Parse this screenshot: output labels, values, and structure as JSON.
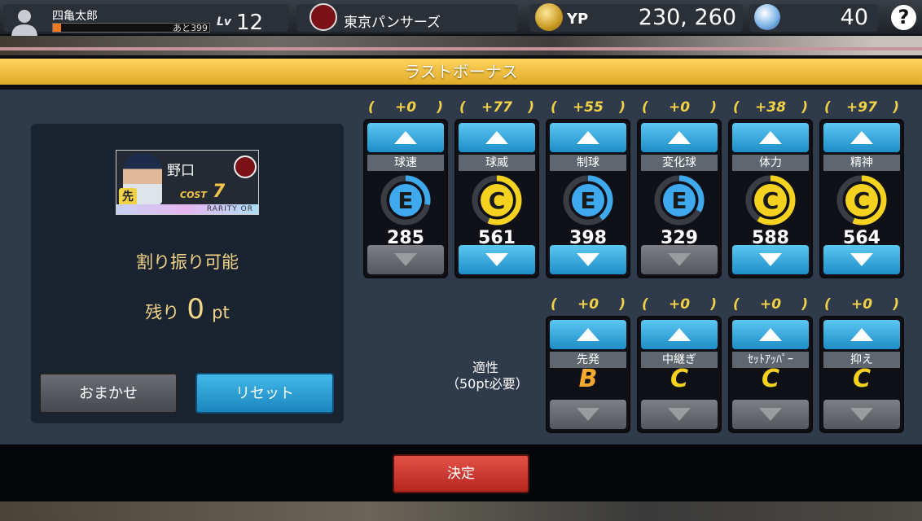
{
  "header": {
    "user_name": "四亀太郎",
    "exp_remaining": "あと399",
    "exp_progress_percent": 5,
    "level_label": "Lv",
    "level": "12",
    "team_name": "東京パンサーズ",
    "currency_label": "YP",
    "currency_value": "230, 260",
    "ball_count": "40",
    "help_label": "?"
  },
  "title": "ラストボーナス",
  "player_card": {
    "name": "野口",
    "position": "先",
    "cost_label": "COST",
    "cost": "7",
    "rarity": "RARITY OR"
  },
  "allocation": {
    "status": "割り振り可能",
    "remaining_label": "残り",
    "remaining_value": "0",
    "remaining_unit": "pt"
  },
  "buttons": {
    "auto": "おまかせ",
    "reset": "リセット",
    "confirm": "決定"
  },
  "stats": [
    {
      "bonus": "+0",
      "label": "球速",
      "grade": "E",
      "value": "285",
      "gauge_fraction": 0.28,
      "grade_color": "#3fa9ee",
      "down_enabled": false
    },
    {
      "bonus": "+77",
      "label": "球威",
      "grade": "C",
      "value": "561",
      "gauge_fraction": 0.56,
      "grade_color": "#f4d21f",
      "down_enabled": true
    },
    {
      "bonus": "+55",
      "label": "制球",
      "grade": "E",
      "value": "398",
      "gauge_fraction": 0.4,
      "grade_color": "#3fa9ee",
      "down_enabled": true
    },
    {
      "bonus": "+0",
      "label": "変化球",
      "grade": "E",
      "value": "329",
      "gauge_fraction": 0.33,
      "grade_color": "#3fa9ee",
      "down_enabled": false
    },
    {
      "bonus": "+38",
      "label": "体力",
      "grade": "C",
      "value": "588",
      "gauge_fraction": 0.59,
      "grade_color": "#f4d21f",
      "down_enabled": true
    },
    {
      "bonus": "+97",
      "label": "精神",
      "grade": "C",
      "value": "564",
      "gauge_fraction": 0.56,
      "grade_color": "#f4d21f",
      "down_enabled": true
    }
  ],
  "aptitude": {
    "heading_line1": "適性",
    "heading_line2": "（50pt必要）",
    "items": [
      {
        "bonus": "+0",
        "label": "先発",
        "grade": "B",
        "grade_color": "#f6a92f"
      },
      {
        "bonus": "+0",
        "label": "中継ぎ",
        "grade": "C",
        "grade_color": "#f4d21f"
      },
      {
        "bonus": "+0",
        "label": "ｾｯﾄｱｯﾊﾟｰ",
        "grade": "C",
        "grade_color": "#f4d21f"
      },
      {
        "bonus": "+0",
        "label": "抑え",
        "grade": "C",
        "grade_color": "#f4d21f"
      }
    ]
  },
  "icons": {
    "avatar": "user-silhouette-icon",
    "team": "team-logo-icon",
    "coin": "coin-icon",
    "ball": "baseball-icon",
    "help": "help-icon",
    "up": "arrow-up-icon",
    "down": "arrow-down-icon"
  },
  "colors": {
    "title_bar": "#e6b032",
    "panel": "#2f3a4b",
    "accent_blue": "#1e8ec7",
    "confirm_red": "#c8322a"
  }
}
